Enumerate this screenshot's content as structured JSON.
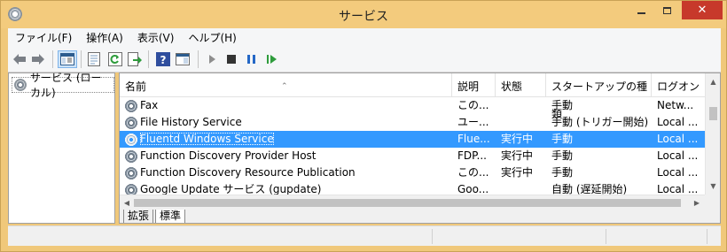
{
  "window": {
    "title": "サービス",
    "minimize": "minimize",
    "maximize": "maximize",
    "close": "✕"
  },
  "menu": [
    {
      "label": "ファイル(F)"
    },
    {
      "label": "操作(A)"
    },
    {
      "label": "表示(V)"
    },
    {
      "label": "ヘルプ(H)"
    }
  ],
  "toolbar": {
    "icons": [
      "back-arrow-icon",
      "forward-arrow-icon",
      "console-tree-icon",
      "properties-icon",
      "refresh-icon",
      "export-list-icon",
      "help-icon",
      "show-hide-pane-icon",
      "start-service-icon",
      "stop-service-icon",
      "pause-service-icon",
      "restart-service-icon"
    ]
  },
  "tree": {
    "node_label": "サービス (ローカル)"
  },
  "columns": {
    "name": "名前",
    "description": "説明",
    "status": "状態",
    "startup": "スタートアップの種類",
    "logon": "ログオン"
  },
  "services": [
    {
      "name": "Fax",
      "description": "この...",
      "status": "",
      "startup": "手動",
      "logon": "Netw..."
    },
    {
      "name": "File History Service",
      "description": "ユー...",
      "status": "",
      "startup": "手動 (トリガー開始)",
      "logon": "Local ..."
    },
    {
      "name": "Fluentd Windows Service",
      "description": "Flue...",
      "status": "実行中",
      "startup": "手動",
      "logon": "Local ..."
    },
    {
      "name": "Function Discovery Provider Host",
      "description": "FDP...",
      "status": "実行中",
      "startup": "手動",
      "logon": "Local ..."
    },
    {
      "name": "Function Discovery Resource Publication",
      "description": "この...",
      "status": "実行中",
      "startup": "手動",
      "logon": "Local ..."
    },
    {
      "name": "Google Update サービス (gupdate)",
      "description": "Goo...",
      "status": "",
      "startup": "自動 (遅延開始)",
      "logon": "Local ..."
    }
  ],
  "selected_index": 2,
  "view_tabs": [
    {
      "label": "拡張"
    },
    {
      "label": "標準"
    }
  ],
  "active_tab": 1,
  "colors": {
    "frame": "#f0c87a",
    "selection": "#3399ff",
    "close_button": "#c7392b"
  }
}
